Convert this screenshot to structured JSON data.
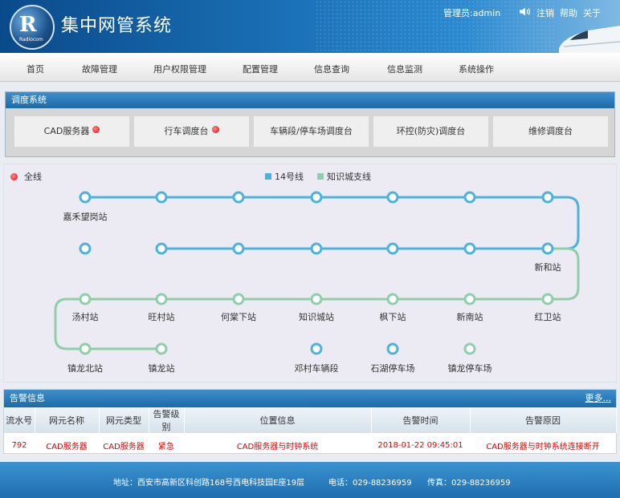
{
  "header": {
    "logo_text": "Radiocom",
    "title": "集中网管系统",
    "user": "管理员:admin",
    "links": [
      "注销",
      "帮助",
      "关于"
    ]
  },
  "menu": [
    "首页",
    "故障管理",
    "用户权限管理",
    "配置管理",
    "信息查询",
    "信息监测",
    "系统操作"
  ],
  "dispatch": {
    "title": "调度系统",
    "tabs": [
      {
        "label": "CAD服务器",
        "alert": true
      },
      {
        "label": "行车调度台",
        "alert": true
      },
      {
        "label": "车辆段/停车场调度台",
        "alert": false
      },
      {
        "label": "环控(防灾)调度台",
        "alert": false
      },
      {
        "label": "维修调度台",
        "alert": false
      }
    ]
  },
  "map": {
    "all_label": "全线",
    "legend": [
      {
        "name": "14号线",
        "color": "#4db3dc"
      },
      {
        "name": "知识城支线",
        "color": "#8fcfa8"
      }
    ],
    "stations": [
      {
        "name": "嘉禾望岗站",
        "line": "14号线"
      },
      {
        "name": "新和站",
        "line": "14号线"
      },
      {
        "name": "汤村站",
        "line": "知识城支线"
      },
      {
        "name": "旺村站",
        "line": "知识城支线"
      },
      {
        "name": "何棠下站",
        "line": "知识城支线"
      },
      {
        "name": "知识城站",
        "line": "知识城支线"
      },
      {
        "name": "枫下站",
        "line": "知识城支线"
      },
      {
        "name": "新南站",
        "line": "知识城支线"
      },
      {
        "name": "红卫站",
        "line": "知识城支线"
      },
      {
        "name": "镇龙北站",
        "line": "知识城支线"
      },
      {
        "name": "镇龙站",
        "line": "知识城支线"
      },
      {
        "name": "邓村车辆段",
        "line": "14号线"
      },
      {
        "name": "石湖停车场",
        "line": "14号线"
      },
      {
        "name": "镇龙停车场",
        "line": "知识城支线"
      }
    ]
  },
  "alarm": {
    "title": "告警信息",
    "more": "更多...",
    "columns": [
      "流水号",
      "网元名称",
      "网元类型",
      "告警级别",
      "位置信息",
      "告警时间",
      "告警原因"
    ],
    "rows": [
      [
        "792",
        "CAD服务器",
        "CAD服务器",
        "紧急",
        "CAD服务器与时钟系统",
        "2018-01-22 09:45:01",
        "CAD服务器与时钟系统连接断开"
      ]
    ]
  },
  "footer": {
    "address": "地址：西安市高新区科创路168号西电科技园E座19层",
    "phone": "电话：029-88236959",
    "fax": "传真：029-88236959"
  }
}
